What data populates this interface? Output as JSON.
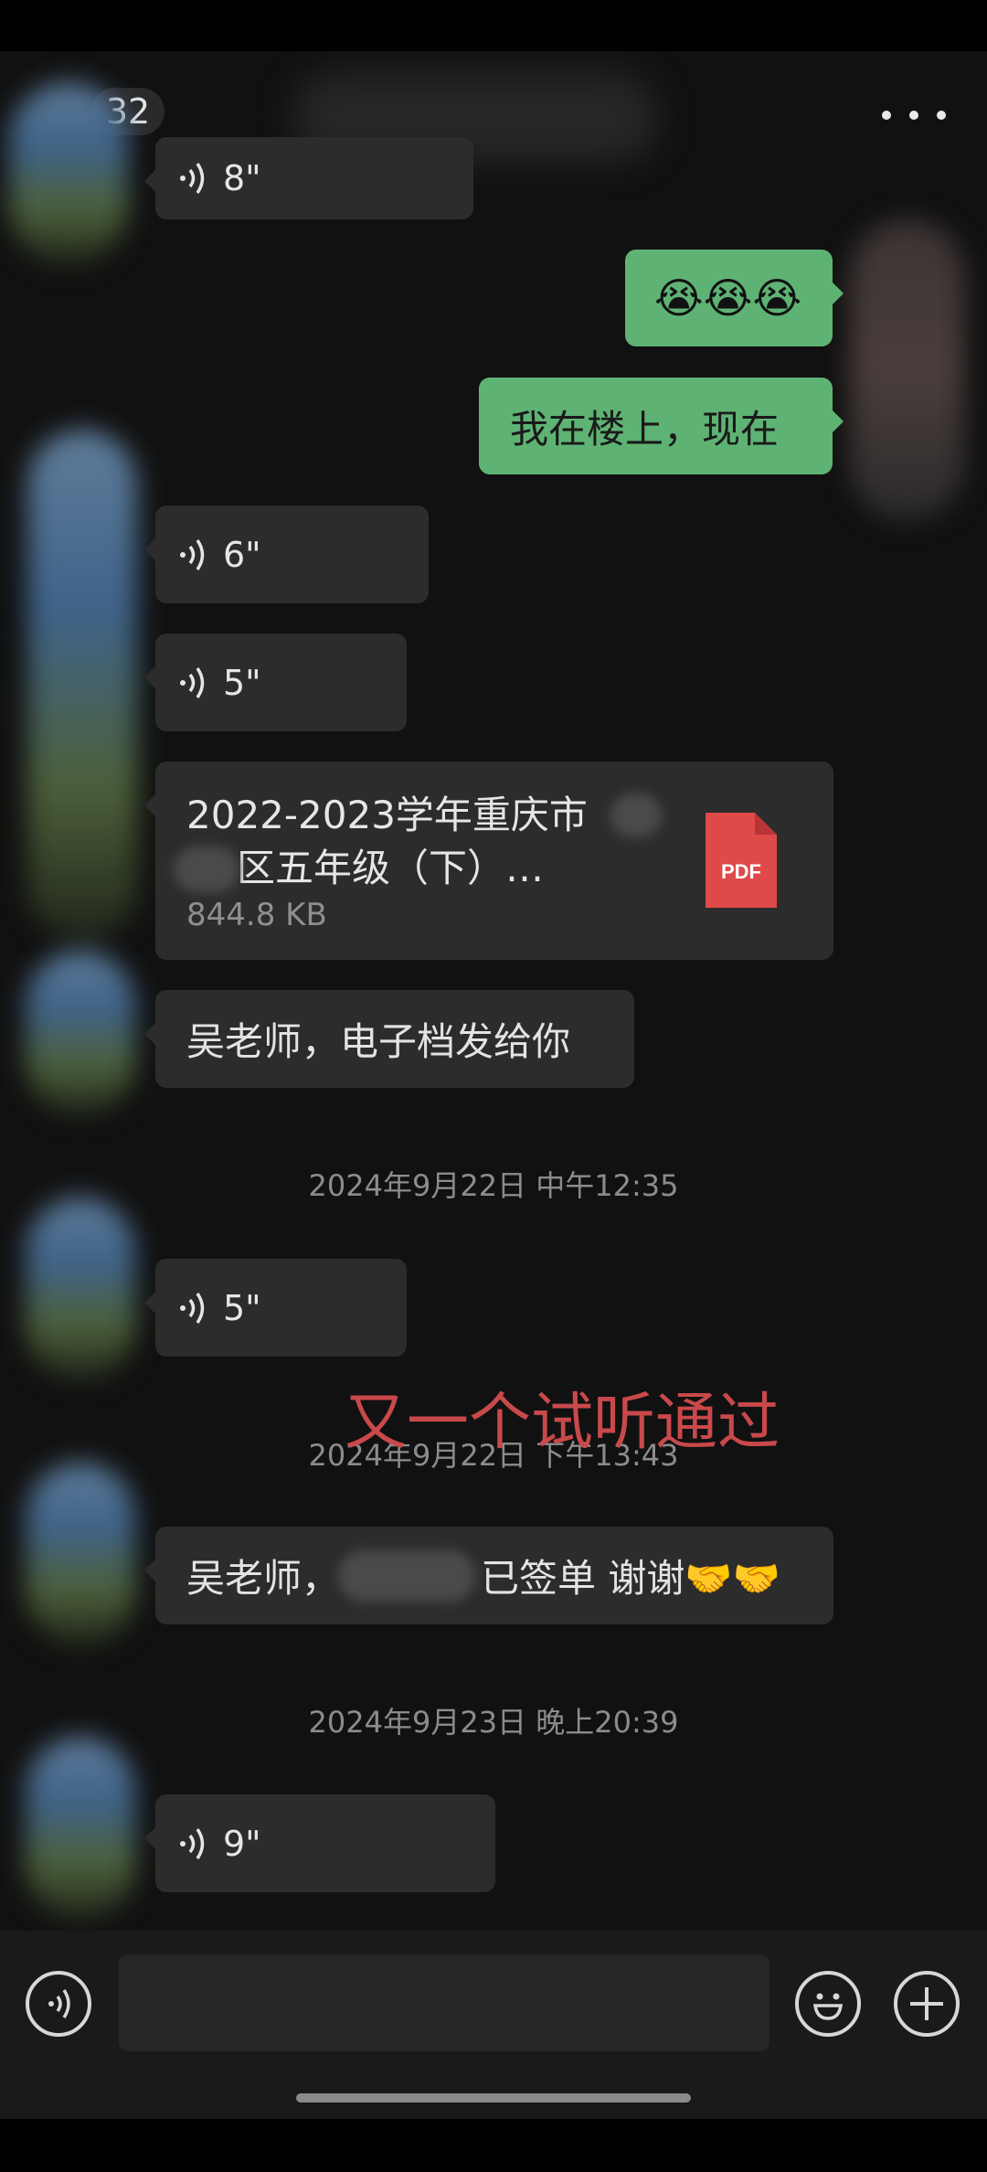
{
  "header": {
    "back_count": "32"
  },
  "messages": {
    "voice_partial": "8\"",
    "emoji_msg": "😭😭😭",
    "text_out_1": "我在楼上，现在",
    "voice_1": "6\"",
    "voice_2": "5\"",
    "file": {
      "title_line1": "2022-2023学年重庆市",
      "title_line2": "区五年级（下）…",
      "size": "844.8 KB",
      "icon_label": "PDF"
    },
    "text_in_1": "吴老师，电子档发给你",
    "time_1": "2024年9月22日 中午12:35",
    "voice_3": "5\"",
    "overlay_text": "又一个试听通过",
    "time_2": "2024年9月22日 下午13:43",
    "text_in_2_a": "吴老师，",
    "text_in_2_b": "已签单  谢谢🤝🤝",
    "time_3": "2024年9月23日 晚上20:39",
    "voice_4": "9\""
  },
  "colors": {
    "outgoing_bubble": "#5eb374",
    "incoming_bubble": "#2c2c2c",
    "overlay_text": "#c9494b",
    "background": "#111111"
  }
}
